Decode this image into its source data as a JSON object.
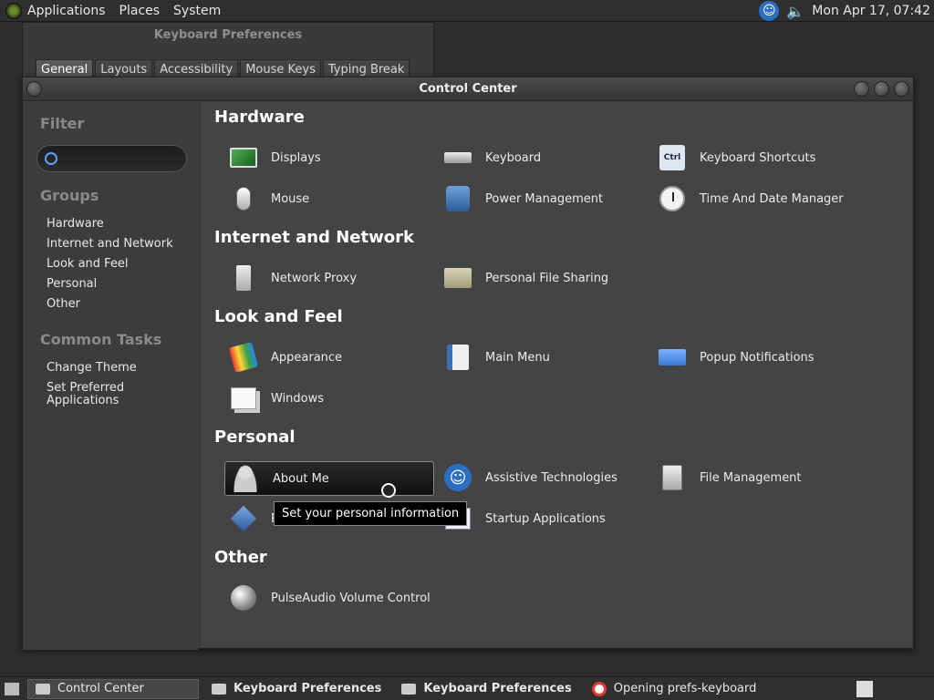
{
  "top_panel": {
    "menus": [
      "Applications",
      "Places",
      "System"
    ],
    "clock": "Mon Apr 17, 07:42"
  },
  "kbd_window": {
    "title": "Keyboard Preferences",
    "tabs": [
      "General",
      "Layouts",
      "Accessibility",
      "Mouse Keys",
      "Typing Break"
    ]
  },
  "cc_window": {
    "title": "Control Center"
  },
  "sidebar": {
    "filter_heading": "Filter",
    "filter_value": "",
    "groups_heading": "Groups",
    "groups": [
      "Hardware",
      "Internet and Network",
      "Look and Feel",
      "Personal",
      "Other"
    ],
    "tasks_heading": "Common Tasks",
    "tasks": [
      "Change Theme",
      "Set Preferred Applications"
    ]
  },
  "sections": {
    "hardware": {
      "title": "Hardware",
      "items": [
        "Displays",
        "Keyboard",
        "Keyboard Shortcuts",
        "Mouse",
        "Power Management",
        "Time And Date Manager"
      ]
    },
    "internet": {
      "title": "Internet and Network",
      "items": [
        "Network Proxy",
        "Personal File Sharing"
      ]
    },
    "look": {
      "title": "Look and Feel",
      "items": [
        "Appearance",
        "Main Menu",
        "Popup Notifications",
        "Windows"
      ]
    },
    "personal": {
      "title": "Personal",
      "items": [
        "About Me",
        "Assistive Technologies",
        "File Management",
        "P",
        "Startup Applications"
      ]
    },
    "other": {
      "title": "Other",
      "items": [
        "PulseAudio Volume Control"
      ]
    }
  },
  "tooltip": "Set your personal information",
  "bottom_panel": {
    "tasks": [
      "Control Center",
      "Keyboard Preferences",
      "Keyboard Preferences",
      "Opening prefs-keyboard"
    ]
  },
  "icons": {
    "kbd_shortcuts_key": "Ctrl"
  }
}
